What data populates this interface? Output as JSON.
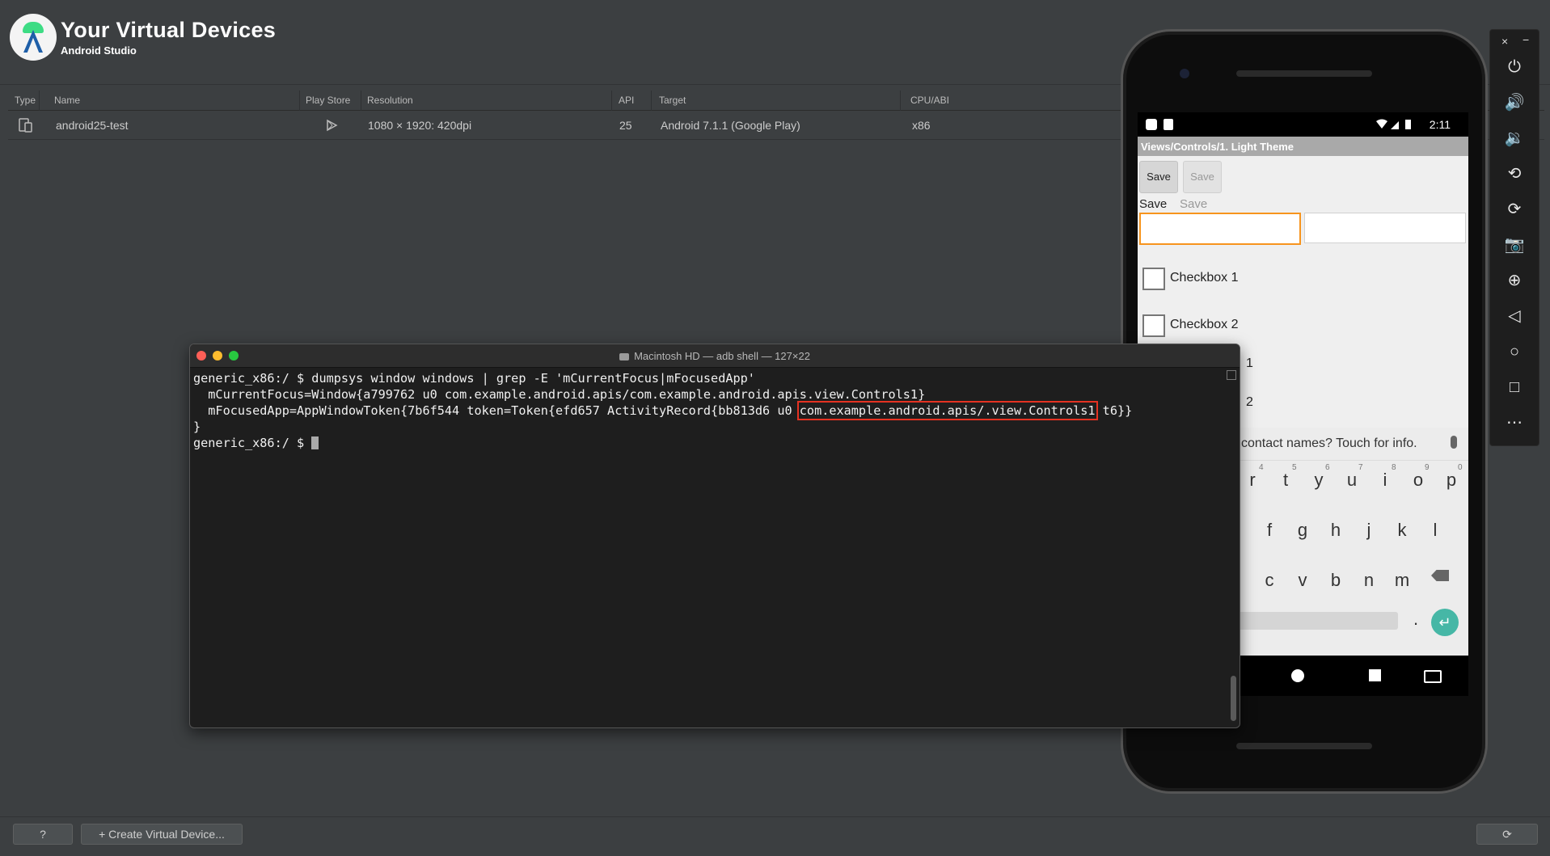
{
  "header": {
    "title": "Your Virtual Devices",
    "subtitle": "Android Studio"
  },
  "table": {
    "columns": [
      "Type",
      "Name",
      "Play Store",
      "Resolution",
      "API",
      "Target",
      "CPU/ABI"
    ],
    "rows": [
      {
        "type_icon": "device-icon",
        "name": "android25-test",
        "play_store_icon": "play-store-icon",
        "resolution": "1080 × 1920: 420dpi",
        "api": "25",
        "target": "Android 7.1.1 (Google Play)",
        "cpu": "x86"
      }
    ]
  },
  "terminal": {
    "title": "Macintosh HD — adb shell — 127×22",
    "lines": {
      "l1": "generic_x86:/ $ dumpsys window windows | grep -E 'mCurrentFocus|mFocusedApp'",
      "l2": "  mCurrentFocus=Window{a799762 u0 com.example.android.apis/com.example.android.apis.view.Controls1}",
      "l3_pre": "  mFocusedApp=AppWindowToken{7b6f544 token=Token{efd657 ActivityRecord{bb813d6 u0 ",
      "l3_hl": "com.example.android.apis/.view.Controls1",
      "l3_post": " t6}}",
      "l4": "}",
      "l5": "generic_x86:/ $ "
    },
    "highlight_color": "#e53222"
  },
  "emulator": {
    "time": "2:11",
    "screen_title": "Views/Controls/1. Light Theme",
    "button_save": "Save",
    "button_save_disabled": "Save",
    "text_save": "Save",
    "text_save_disabled": "Save",
    "checkbox1": "Checkbox 1",
    "checkbox2": "Checkbox 2",
    "frag1": "1",
    "frag2": "2",
    "suggestion": "contact names? Touch for info.",
    "row1_keys": [
      "r",
      "t",
      "y",
      "u",
      "i",
      "o",
      "p"
    ],
    "row1_nums": [
      "4",
      "5",
      "6",
      "7",
      "8",
      "9",
      "0"
    ],
    "row2_keys": [
      "f",
      "g",
      "h",
      "j",
      "k",
      "l"
    ],
    "row3_keys": [
      "c",
      "v",
      "b",
      "n",
      "m"
    ],
    "period": ".",
    "enter": "↵",
    "accent": "#46b7a6",
    "focus_color": "#f7941d"
  },
  "toolbar": {
    "close": "×",
    "minimize": "−",
    "icons": [
      "power-icon",
      "volume-up-icon",
      "volume-down-icon",
      "rotate-left-icon",
      "rotate-right-icon",
      "camera-icon",
      "zoom-icon",
      "back-icon",
      "home-icon",
      "overview-icon",
      "more-icon"
    ],
    "glyphs": [
      "⏻",
      "🔊",
      "🔉",
      "⟲",
      "⟳",
      "📷",
      "⊕",
      "◁",
      "○",
      "□",
      "⋯"
    ]
  },
  "bottom": {
    "help": "?",
    "create": "+ Create Virtual Device...",
    "refresh": "⟳"
  }
}
